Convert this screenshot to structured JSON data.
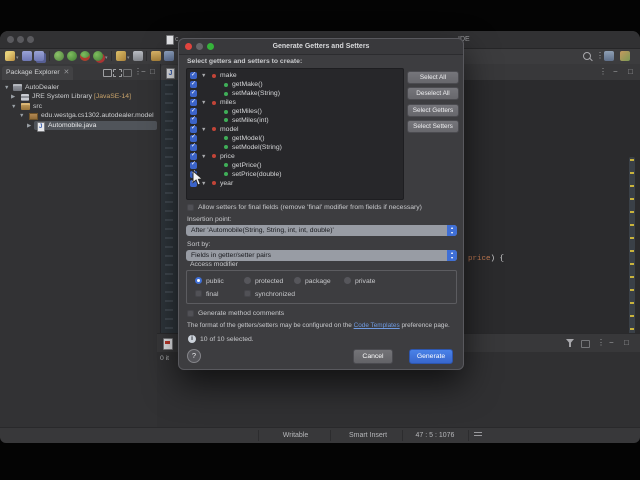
{
  "window": {
    "title_fragment_left": "c",
    "title_fragment_right": "IDE"
  },
  "toolbar": {
    "icons": [
      "new-wizard",
      "save",
      "save-all",
      "debug",
      "run",
      "coverage",
      "run-config",
      "new-class",
      "tasks",
      "open-folder",
      "import-folder"
    ],
    "right_icons": [
      "search",
      "view-menu",
      "open-perspective",
      "java-perspective"
    ]
  },
  "package_explorer": {
    "tab_label": "Package Explorer",
    "header_icons": [
      "collapse-all",
      "link-with-editor",
      "focus",
      "view-menu",
      "minimize",
      "maximize"
    ],
    "tree": [
      {
        "label": "AutoDealer"
      },
      {
        "label": "JRE System Library ",
        "detail": "[JavaSE-14]"
      },
      {
        "label": "src"
      },
      {
        "label": "edu.westga.cs1302.autodealer.model"
      },
      {
        "label": "Automobile.java"
      }
    ]
  },
  "editor": {
    "code_keyword": "price",
    "code_rest": ") {"
  },
  "bottom_panel": {
    "status_fragment": "0 it",
    "header_icons": [
      "filter",
      "flag",
      "view-menu",
      "minimize",
      "maximize"
    ]
  },
  "status_bar": {
    "writable": "Writable",
    "insert_mode": "Smart Insert",
    "caret_position": "47 : 5 : 1076"
  },
  "dialog": {
    "title": "Generate Getters and Setters",
    "header_label": "Select getters and setters to create:",
    "tree": [
      {
        "label": "make",
        "kind": "field",
        "checked": true
      },
      {
        "label": "getMake()",
        "kind": "getter",
        "checked": true
      },
      {
        "label": "setMake(String)",
        "kind": "setter",
        "checked": true
      },
      {
        "label": "miles",
        "kind": "field",
        "checked": true
      },
      {
        "label": "getMiles()",
        "kind": "getter",
        "checked": true
      },
      {
        "label": "setMiles(int)",
        "kind": "setter",
        "checked": true
      },
      {
        "label": "model",
        "kind": "field",
        "checked": true
      },
      {
        "label": "getModel()",
        "kind": "getter",
        "checked": true
      },
      {
        "label": "setModel(String)",
        "kind": "setter",
        "checked": true
      },
      {
        "label": "price",
        "kind": "field",
        "checked": true
      },
      {
        "label": "getPrice()",
        "kind": "getter",
        "checked": true
      },
      {
        "label": "setPrice(double)",
        "kind": "setter",
        "checked": true
      },
      {
        "label": "year",
        "kind": "field",
        "checked": true
      }
    ],
    "side_buttons": [
      "Select All",
      "Deselect All",
      "Select Getters",
      "Select Setters"
    ],
    "allow_setters_label": "Allow setters for final fields (remove 'final' modifier from fields if necessary)",
    "insertion_point_label": "Insertion point:",
    "insertion_point_value": "After 'Automobile(String, String, int, int, double)'",
    "sort_by_label": "Sort by:",
    "sort_by_value": "Fields in getter/setter pairs",
    "access_modifier": {
      "legend": "Access modifier",
      "radios": [
        "public",
        "protected",
        "package",
        "private"
      ],
      "selected": "public",
      "checkboxes": [
        "final",
        "synchronized"
      ]
    },
    "generate_comments_label": "Generate method comments",
    "format_text_before": "The format of the getters/setters may be configured on the ",
    "format_link_label": "Code Templates",
    "format_text_after": " preference page.",
    "selection_status": "10 of 10 selected.",
    "help_label": "?",
    "cancel_label": "Cancel",
    "generate_label": "Generate"
  },
  "colors": {
    "dialog_accent": "#3f6fd6",
    "generate_button": "#3e72d8",
    "checkbox_checked": "#3b63c8",
    "link": "#6f9ae0",
    "keyword_orange": "#c57b52"
  }
}
